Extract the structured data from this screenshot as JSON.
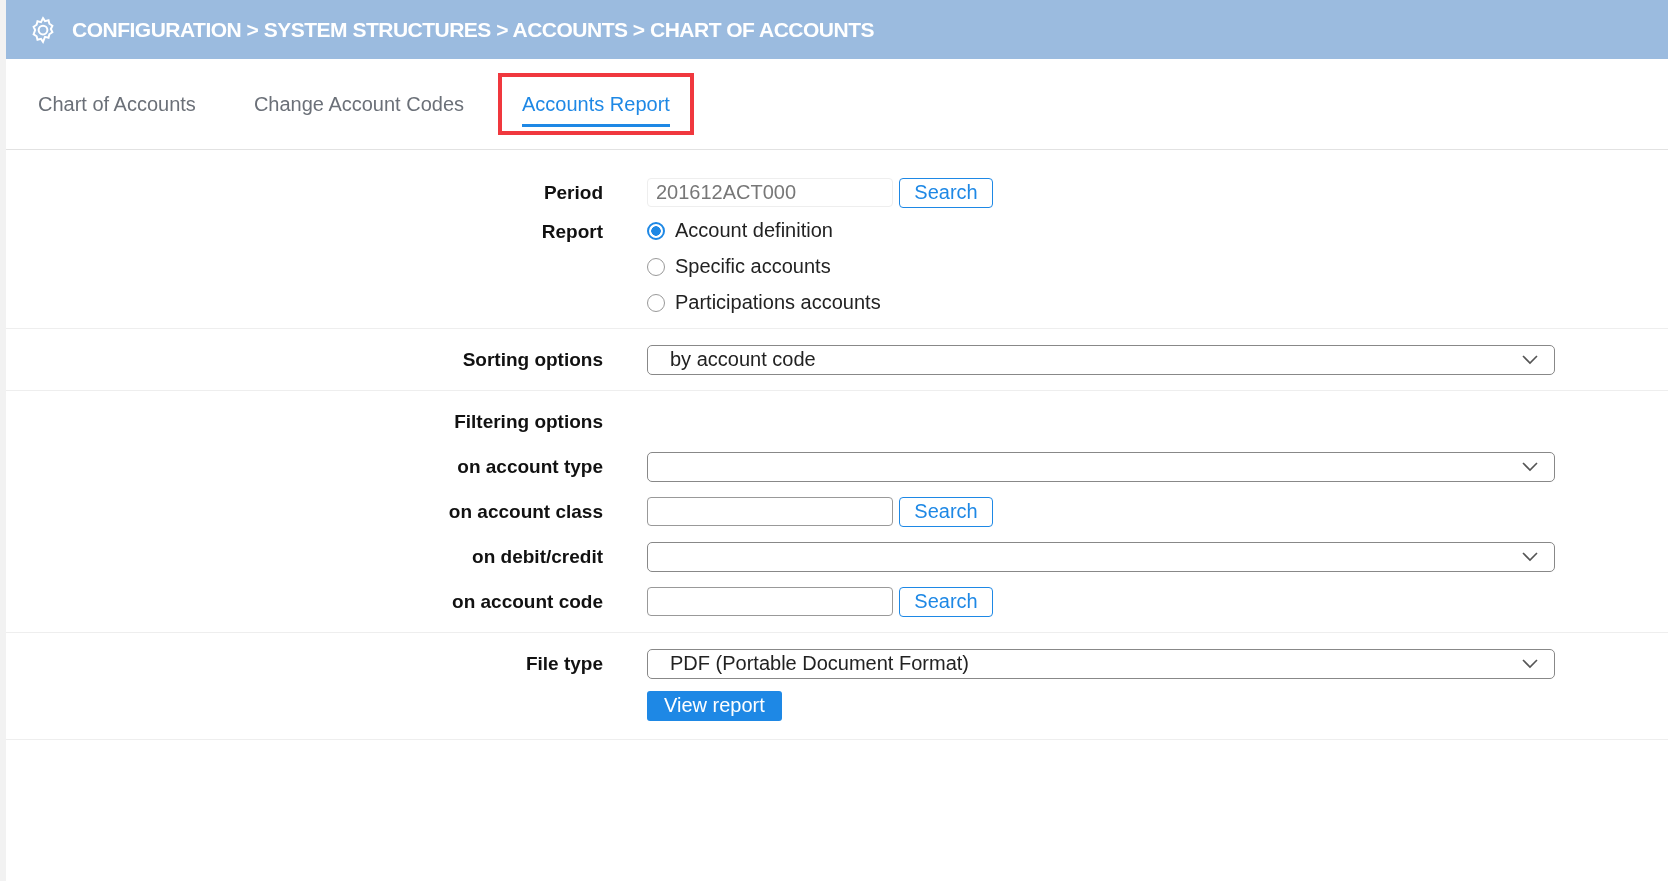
{
  "header": {
    "breadcrumb": "CONFIGURATION > SYSTEM STRUCTURES > ACCOUNTS > CHART OF ACCOUNTS"
  },
  "tabs": [
    {
      "label": "Chart of Accounts",
      "selected": false,
      "highlighted": false
    },
    {
      "label": "Change Account Codes",
      "selected": false,
      "highlighted": false
    },
    {
      "label": "Accounts Report",
      "selected": true,
      "highlighted": true
    }
  ],
  "sections": [
    {
      "rows": [
        {
          "kind": "text_search",
          "label": "Period",
          "value": "201612ACT000",
          "button": "Search"
        },
        {
          "kind": "radio",
          "label": "Report",
          "options": [
            {
              "label": "Account definition",
              "selected": true
            },
            {
              "label": "Specific accounts",
              "selected": false
            },
            {
              "label": "Participations accounts",
              "selected": false
            }
          ]
        }
      ]
    },
    {
      "rows": [
        {
          "kind": "select",
          "label": "Sorting options",
          "value": "by account code"
        }
      ]
    },
    {
      "rows": [
        {
          "kind": "heading",
          "label": "Filtering options"
        },
        {
          "kind": "select",
          "label": "on account type",
          "value": ""
        },
        {
          "kind": "text_search",
          "label": "on account class",
          "value": "",
          "button": "Search"
        },
        {
          "kind": "select",
          "label": "on debit/credit",
          "value": ""
        },
        {
          "kind": "text_search",
          "label": "on account code",
          "value": "",
          "button": "Search"
        }
      ]
    },
    {
      "rows": [
        {
          "kind": "select",
          "label": "File type",
          "value": "PDF (Portable Document Format)"
        },
        {
          "kind": "action",
          "label": "",
          "button": "View report"
        }
      ]
    }
  ]
}
